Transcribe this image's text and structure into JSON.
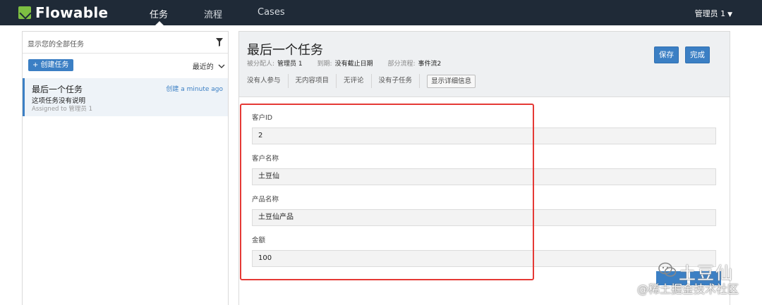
{
  "nav": {
    "logo_text": "Flowable",
    "items": [
      "任务",
      "流程",
      "Cases"
    ],
    "active": "任务",
    "user": "管理员 1"
  },
  "task_list": {
    "filter_label": "显示您的全部任务",
    "create_button": "+ 创建任务",
    "sort_label": "最近的",
    "items": [
      {
        "name": "最后一个任务",
        "created": "创建 a minute ago",
        "description": "这项任务没有说明",
        "assigned": "Assigned to 管理员 1"
      }
    ]
  },
  "task_detail": {
    "title": "最后一个任务",
    "assignee_label": "被分配人:",
    "assignee": "管理员 1",
    "due_label": "到期:",
    "due": "没有截止日期",
    "process_label": "部分流程:",
    "process": "事件流2",
    "save_button": "保存",
    "complete_button": "完成",
    "tabs": [
      "没有人参与",
      "无内容项目",
      "无评论",
      "没有子任务"
    ],
    "details_button": "显示详细信息"
  },
  "form": {
    "fields": [
      {
        "label": "客户ID",
        "value": "2"
      },
      {
        "label": "客户名称",
        "value": "土豆仙"
      },
      {
        "label": "产品名称",
        "value": "土豆仙产品"
      },
      {
        "label": "金额",
        "value": "100"
      }
    ]
  },
  "watermark": {
    "line1": "土豆仙",
    "line2": "@稀土掘金技术社区"
  },
  "colors": {
    "navbar": "#1f2a37",
    "accent": "#3b7fc4",
    "logo_green": "#7dbf42",
    "highlight_red": "#e53935"
  }
}
